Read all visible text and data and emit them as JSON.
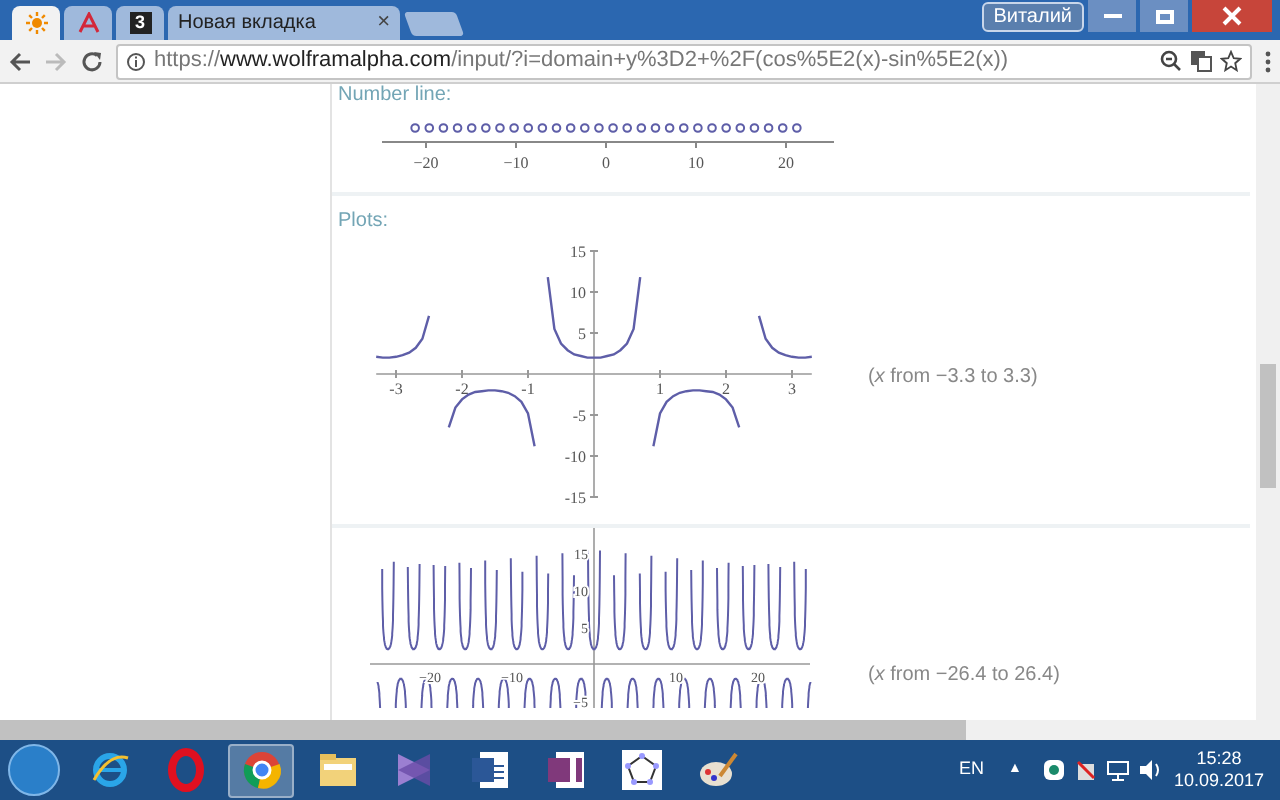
{
  "browser": {
    "tabs": [
      {
        "kind": "sun",
        "selected": true
      },
      {
        "kind": "letter-logo",
        "selected": false
      },
      {
        "kind": "text-logo",
        "logo_text": "3",
        "selected": false
      },
      {
        "kind": "title",
        "title": "Новая вкладка",
        "close": "×",
        "selected": false
      }
    ],
    "profile": "Виталий",
    "url": "https://**www.wolframalpha.com**/input/?i=domain+y%3D2+%2F(cos%5E2(x)-sin%5E2(x))"
  },
  "number_line": {
    "label": "Number line:",
    "tick_labels": [
      "−20",
      "−10",
      "0",
      "10",
      "20"
    ]
  },
  "plots": {
    "label": "Plots:",
    "plot_1": {
      "range_note": "(*x* from −3.3 to 3.3)",
      "chart_data": {
        "type": "line",
        "x": [
          -3.3,
          -3.2,
          -3.1,
          -3.0,
          -2.9,
          -2.8,
          -2.7,
          -2.6,
          -2.5,
          -2.4,
          -2.3,
          -2.2,
          -2.1,
          -2.0,
          -1.9,
          -1.8,
          -1.7,
          -1.6,
          -1.5,
          -1.4,
          -1.3,
          -1.2,
          -1.1,
          -1.0,
          -0.9,
          -0.8,
          -0.7,
          -0.6,
          -0.5,
          -0.4,
          -0.3,
          -0.2,
          -0.1,
          0,
          0.1,
          0.2,
          0.3,
          0.4,
          0.5,
          0.6,
          0.7,
          0.8,
          0.9,
          1.0,
          1.1,
          1.2,
          1.3,
          1.4,
          1.5,
          1.6,
          1.7,
          1.8,
          1.9,
          2.0,
          2.1,
          2.2,
          2.3,
          2.4,
          2.5,
          2.6,
          2.7,
          2.8,
          2.9,
          3.0,
          3.1,
          3.2,
          3.3
        ],
        "series": [
          {
            "color": "#5e5ea8",
            "values": [
              2.1,
              2.0,
              2.0,
              2.1,
              2.3,
              2.6,
              3.2,
              4.3,
              7.1,
              null,
              null,
              -6.5,
              -4.1,
              -3.1,
              -2.5,
              -2.2,
              -2.1,
              -2.0,
              -2.0,
              -2.1,
              -2.3,
              -2.7,
              -3.4,
              -4.8,
              -8.8,
              null,
              11.8,
              5.5,
              3.7,
              2.9,
              2.4,
              2.2,
              2.0,
              2.0,
              2.0,
              2.2,
              2.4,
              2.9,
              3.7,
              5.5,
              11.8,
              null,
              -8.8,
              -4.8,
              -3.4,
              -2.7,
              -2.3,
              -2.1,
              -2.0,
              -2.0,
              -2.1,
              -2.2,
              -2.5,
              -3.1,
              -4.1,
              -6.5,
              null,
              null,
              7.1,
              4.3,
              3.2,
              2.6,
              2.3,
              2.1,
              2.0,
              2.0,
              2.1
            ]
          }
        ],
        "xlim": [
          -3.3,
          3.3
        ],
        "ylim": [
          -15,
          15
        ],
        "xticks": [
          -3,
          -2,
          -1,
          1,
          2,
          3
        ],
        "yticks": [
          -15,
          -10,
          -5,
          5,
          10,
          15
        ]
      }
    },
    "plot_2": {
      "range_note": "(*x* from −26.4 to 26.4)",
      "x_tick_labels": [
        "−20",
        "−10",
        "10",
        "20"
      ],
      "y_tick_labels": [
        "15",
        "10",
        "5",
        "−5"
      ]
    }
  },
  "taskbar": {
    "apps": [
      {
        "kind": "ie",
        "selected": false
      },
      {
        "kind": "opera",
        "selected": false
      },
      {
        "kind": "chrome",
        "selected": true
      },
      {
        "kind": "folder",
        "selected": false
      },
      {
        "kind": "studio",
        "selected": false
      },
      {
        "kind": "word",
        "selected": false
      },
      {
        "kind": "onenote",
        "selected": false
      },
      {
        "kind": "geometry",
        "selected": false
      },
      {
        "kind": "paint",
        "selected": false
      }
    ],
    "language": "EN",
    "tray_arrow": "▲",
    "time": "15:28",
    "date": "10.09.2017"
  }
}
